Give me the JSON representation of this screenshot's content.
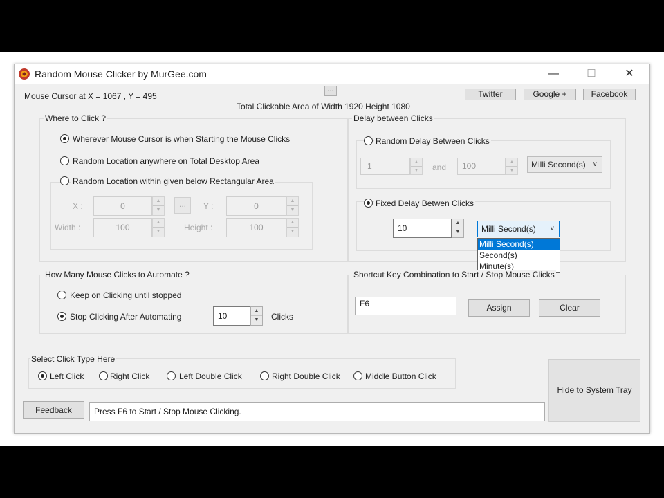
{
  "window": {
    "title": "Random Mouse Clicker by MurGee.com",
    "minimize": "—",
    "maximize": "☐",
    "close": "✕"
  },
  "header": {
    "cursor_position": "Mouse Cursor at X = 1067 , Y = 495",
    "ellipsis": "...",
    "clickable_area": "Total Clickable Area of Width 1920 Height 1080",
    "twitter": "Twitter",
    "google": "Google +",
    "facebook": "Facebook"
  },
  "where": {
    "title": "Where to Click ?",
    "options": [
      "Wherever Mouse Cursor is when Starting the Mouse Clicks",
      "Random Location anywhere on Total Desktop Area",
      "Random Location within given below Rectangular Area"
    ],
    "x_label": "X :",
    "x_value": "0",
    "pick_button": "...",
    "y_label": "Y :",
    "y_value": "0",
    "width_label": "Width :",
    "width_value": "100",
    "height_label": "Height :",
    "height_value": "100"
  },
  "delay": {
    "title": "Delay between Clicks",
    "random_label": "Random Delay Between Clicks",
    "random_min": "1",
    "and_label": "and",
    "random_max": "100",
    "random_unit": "Milli Second(s)",
    "fixed_label": "Fixed Delay Betwen Clicks",
    "fixed_value": "10",
    "fixed_unit": "Milli Second(s)",
    "unit_options": [
      "Milli Second(s)",
      "Second(s)",
      "Minute(s)"
    ]
  },
  "count": {
    "title": "How Many Mouse Clicks to Automate ?",
    "keep_label": "Keep on Clicking until stopped",
    "stop_label": "Stop Clicking After Automating",
    "stop_value": "10",
    "clicks_label": "Clicks"
  },
  "shortcut": {
    "title": "Shortcut Key Combination to Start / Stop Mouse Clicks",
    "value": "F6",
    "assign": "Assign",
    "clear": "Clear"
  },
  "click_type": {
    "title": "Select Click Type Here",
    "options": [
      "Left Click",
      "Right Click",
      "Left Double Click",
      "Right Double Click",
      "Middle Button Click"
    ]
  },
  "footer": {
    "feedback": "Feedback",
    "status": "Press F6 to Start / Stop Mouse Clicking.",
    "hide_tray": "Hide to System Tray"
  }
}
